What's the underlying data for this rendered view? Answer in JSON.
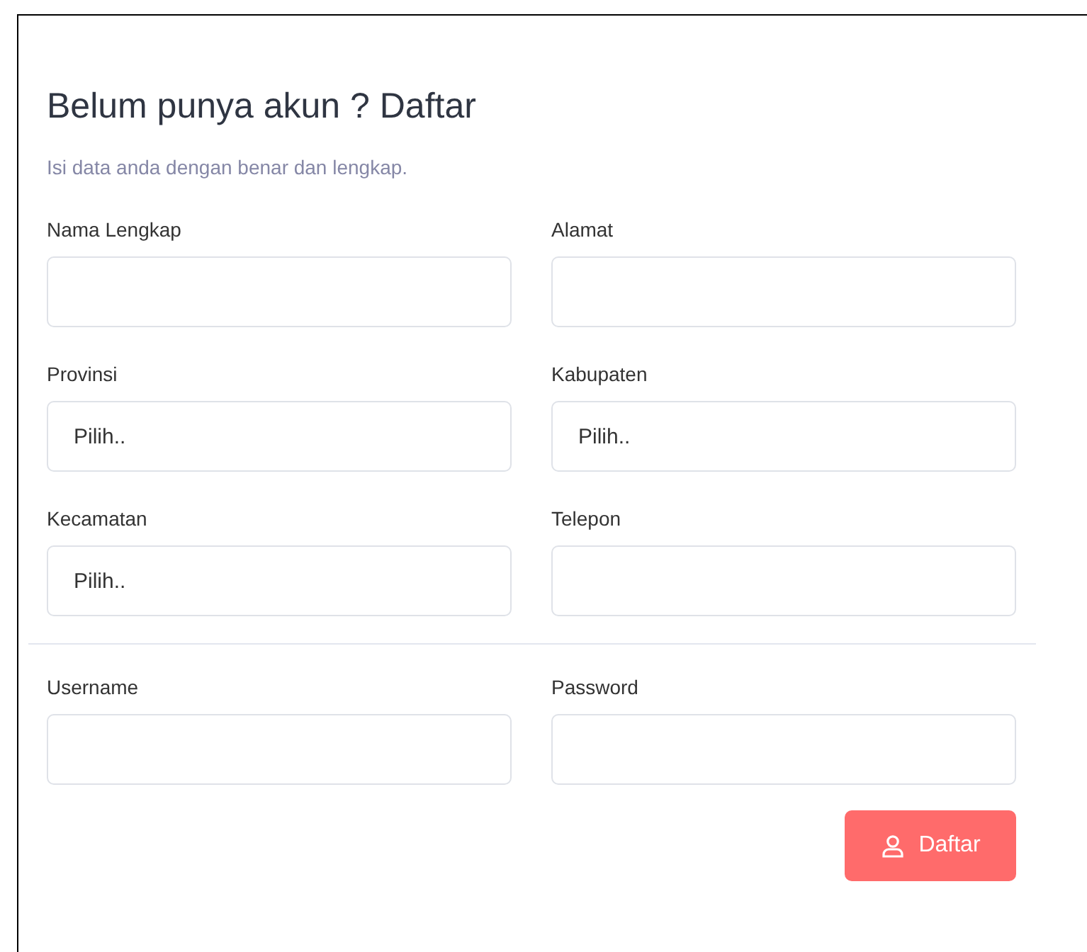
{
  "title": "Belum punya akun ? Daftar",
  "subtitle": "Isi data anda dengan benar dan lengkap.",
  "sections": [
    {
      "fields": [
        {
          "label": "Nama Lengkap",
          "kind": "text"
        },
        {
          "label": "Alamat",
          "kind": "text"
        },
        {
          "label": "Provinsi",
          "kind": "select",
          "value": "Pilih.."
        },
        {
          "label": "Kabupaten",
          "kind": "select",
          "value": "Pilih.."
        },
        {
          "label": "Kecamatan",
          "kind": "select",
          "value": "Pilih.."
        },
        {
          "label": "Telepon",
          "kind": "text"
        }
      ]
    },
    {
      "fields": [
        {
          "label": "Username",
          "kind": "text"
        },
        {
          "label": "Password",
          "kind": "password"
        }
      ]
    }
  ],
  "submit": {
    "label": "Daftar"
  }
}
